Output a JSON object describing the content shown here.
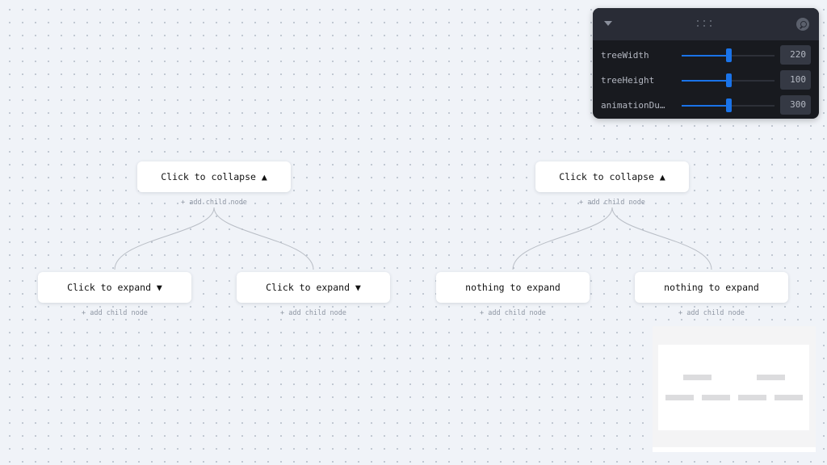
{
  "tree": {
    "roots": [
      {
        "label": "Click to collapse ▲",
        "add_child": "+ add child node",
        "children": [
          {
            "label": "Click to expand ▼",
            "add_child": "+ add child node"
          },
          {
            "label": "Click to expand ▼",
            "add_child": "+ add child node"
          }
        ]
      },
      {
        "label": "Click to collapse ▲",
        "add_child": "+ add child node",
        "children": [
          {
            "label": "nothing to expand",
            "add_child": "+ add child node"
          },
          {
            "label": "nothing to expand",
            "add_child": "+ add child node"
          }
        ]
      }
    ]
  },
  "controls": {
    "toggle_icon": "chevron-down-icon",
    "drag_icon": "drag-handle-icon",
    "search_icon": "search-icon",
    "params": [
      {
        "label": "treeWidth",
        "value": "220",
        "slider_fraction": 0.5
      },
      {
        "label": "treeHeight",
        "value": "100",
        "slider_fraction": 0.5
      },
      {
        "label": "animationDu…",
        "value": "300",
        "slider_fraction": 0.5
      }
    ]
  },
  "colors": {
    "accent": "#1a73e8",
    "canvas_bg": "#f0f3f8",
    "panel_bg": "#181a1f",
    "panel_header": "#292c36"
  }
}
